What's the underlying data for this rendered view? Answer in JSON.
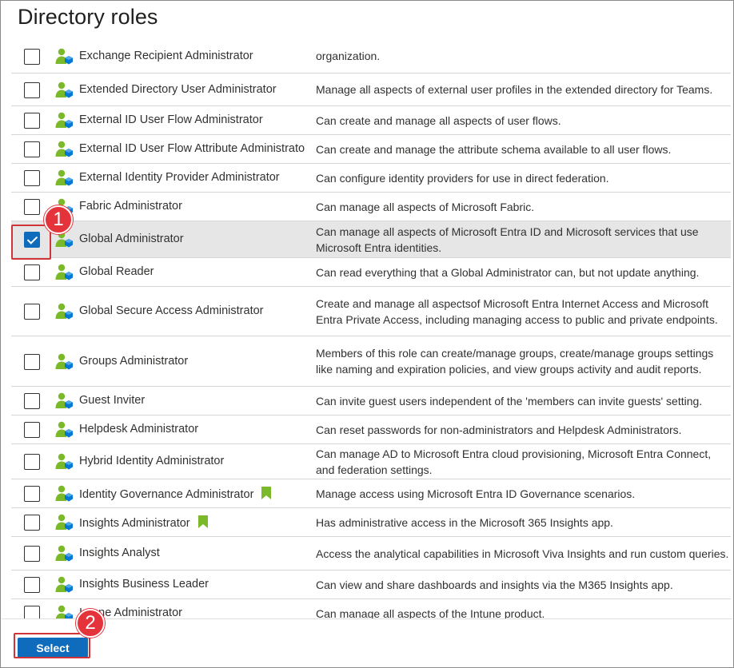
{
  "dialog": {
    "title": "Directory roles",
    "select_label": "Select"
  },
  "callouts": {
    "one": "1",
    "two": "2"
  },
  "colors": {
    "accent": "#0f6cbd",
    "callout": "#e5333b",
    "role_icon_green": "#7ab929",
    "role_icon_blue": "#0078d4"
  },
  "roles": [
    {
      "name": "Exchange Recipient Administrator",
      "description": "organization.",
      "checked": false,
      "bookmark": false
    },
    {
      "name": "Extended Directory User Administrator",
      "description": "Manage all aspects of external user profiles in the extended directory for Teams.",
      "checked": false,
      "bookmark": false
    },
    {
      "name": "External ID User Flow Administrator",
      "description": "Can create and manage all aspects of user flows.",
      "checked": false,
      "bookmark": false
    },
    {
      "name": "External ID User Flow Attribute Administrato",
      "description": "Can create and manage the attribute schema available to all user flows.",
      "checked": false,
      "bookmark": false
    },
    {
      "name": "External Identity Provider Administrator",
      "description": "Can configure identity providers for use in direct federation.",
      "checked": false,
      "bookmark": false
    },
    {
      "name": "Fabric Administrator",
      "description": "Can manage all aspects of Microsoft Fabric.",
      "checked": false,
      "bookmark": false
    },
    {
      "name": "Global Administrator",
      "description": "Can manage all aspects of Microsoft Entra ID and Microsoft services that use Microsoft Entra identities.",
      "checked": true,
      "bookmark": false
    },
    {
      "name": "Global Reader",
      "description": "Can read everything that a Global Administrator can, but not update anything.",
      "checked": false,
      "bookmark": false
    },
    {
      "name": "Global Secure Access Administrator",
      "description": "Create and manage all aspectsof Microsoft Entra Internet Access and Microsoft Entra Private Access, including managing access to public and private endpoints.",
      "checked": false,
      "bookmark": false
    },
    {
      "name": "Groups Administrator",
      "description": "Members of this role can create/manage groups, create/manage groups settings like naming and expiration policies, and view groups activity and audit reports.",
      "checked": false,
      "bookmark": false
    },
    {
      "name": "Guest Inviter",
      "description": "Can invite guest users independent of the 'members can invite guests' setting.",
      "checked": false,
      "bookmark": false
    },
    {
      "name": "Helpdesk Administrator",
      "description": "Can reset passwords for non-administrators and Helpdesk Administrators.",
      "checked": false,
      "bookmark": false
    },
    {
      "name": "Hybrid Identity Administrator",
      "description": "Can manage AD to Microsoft Entra cloud provisioning, Microsoft Entra Connect, and federation settings.",
      "checked": false,
      "bookmark": false
    },
    {
      "name": "Identity Governance Administrator",
      "description": "Manage access using Microsoft Entra ID Governance scenarios.",
      "checked": false,
      "bookmark": true
    },
    {
      "name": "Insights Administrator",
      "description": "Has administrative access in the Microsoft 365 Insights app.",
      "checked": false,
      "bookmark": true
    },
    {
      "name": "Insights Analyst",
      "description": "Access the analytical capabilities in Microsoft Viva Insights and run custom queries.",
      "checked": false,
      "bookmark": false
    },
    {
      "name": "Insights Business Leader",
      "description": "Can view and share dashboards and insights via the M365 Insights app.",
      "checked": false,
      "bookmark": false
    },
    {
      "name": "Intune Administrator",
      "description": "Can manage all aspects of the Intune product.",
      "checked": false,
      "bookmark": false
    }
  ]
}
